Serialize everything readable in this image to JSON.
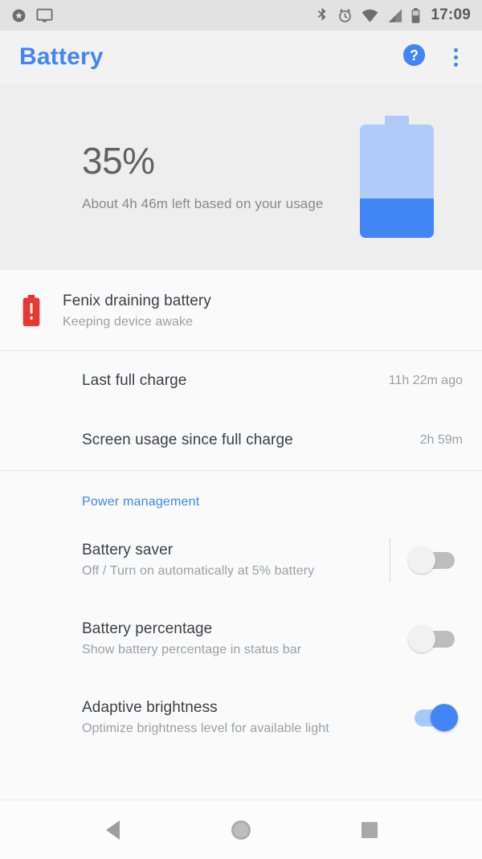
{
  "status_bar": {
    "left_icons": [
      "dnd-star-icon",
      "cast-screen-icon"
    ],
    "right_icons": [
      "bluetooth-icon",
      "alarm-icon",
      "wifi-icon",
      "cellular-signal-icon",
      "battery-icon"
    ],
    "time": "17:09"
  },
  "action_bar": {
    "title": "Battery",
    "help_icon": "help-icon",
    "overflow_icon": "more-vert-icon"
  },
  "summary": {
    "percent": "35%",
    "percent_value": 35,
    "estimate": "About 4h 46m left based on your usage",
    "battery_fill_color": "#4285f4",
    "battery_body_color": "#aecbfa"
  },
  "alert": {
    "icon": "battery-alert-icon",
    "icon_color": "#e53935",
    "title": "Fenix draining battery",
    "subtitle": "Keeping device awake"
  },
  "stats": [
    {
      "label": "Last full charge",
      "value": "11h 22m ago"
    },
    {
      "label": "Screen usage since full charge",
      "value": "2h 59m"
    }
  ],
  "power_management": {
    "header": "Power management",
    "header_color": "#4285f4",
    "items": [
      {
        "title": "Battery saver",
        "subtitle": "Off / Turn on automatically at 5% battery",
        "toggle_state": "off",
        "has_divider": true
      },
      {
        "title": "Battery percentage",
        "subtitle": "Show battery percentage in status bar",
        "toggle_state": "off",
        "has_divider": false
      },
      {
        "title": "Adaptive brightness",
        "subtitle": "Optimize brightness level for available light",
        "toggle_state": "on",
        "has_divider": false
      }
    ]
  },
  "nav_bar": {
    "back": "back-icon",
    "home": "home-icon",
    "recents": "recents-icon"
  }
}
